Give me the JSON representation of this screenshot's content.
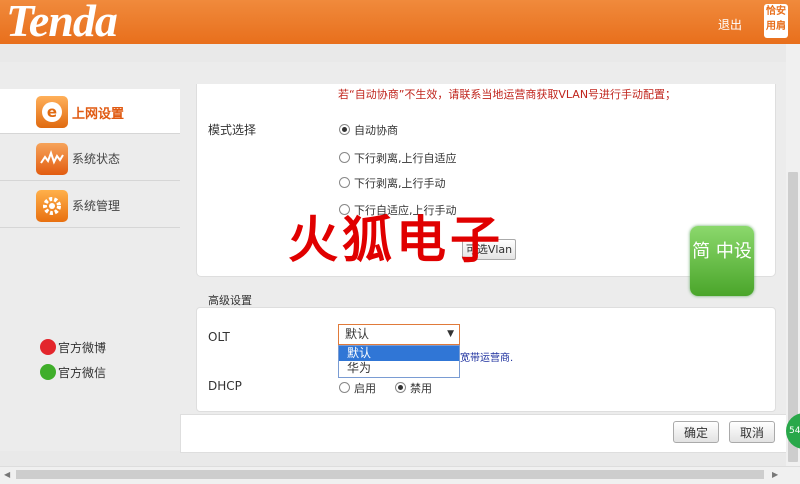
{
  "header": {
    "brand": "Tenda",
    "logout": "退出",
    "corner_badge": "恰安 用肩",
    "brand_color": "#e8731f"
  },
  "sidebar": {
    "items": [
      {
        "label": "上网设置",
        "icon": "internet-e-icon",
        "active": true
      },
      {
        "label": "系统状态",
        "icon": "status-chart-icon",
        "active": false
      },
      {
        "label": "系统管理",
        "icon": "gear-icon",
        "active": false
      }
    ],
    "social": [
      {
        "label": "官方微博",
        "icon": "weibo-icon"
      },
      {
        "label": "官方微信",
        "icon": "wechat-icon"
      }
    ]
  },
  "main": {
    "warning": "若“自动协商”不生效，请联系当地运营商获取VLAN号进行手动配置；",
    "mode_label": "模式选择",
    "mode_options": [
      {
        "label": "自动协商",
        "checked": true
      },
      {
        "label": "下行剥离,上行自适应",
        "checked": false
      },
      {
        "label": "下行剥离,上行手动",
        "checked": false
      },
      {
        "label": "下行自适应,上行手动",
        "checked": false
      }
    ],
    "vlan_button": "可选Vlan",
    "watermark": "火狐电子",
    "corner_badge": "简 中设",
    "advanced_title": "高级设置",
    "olt_label": "OLT",
    "olt_selected": "默认",
    "olt_options": [
      "默认",
      "华为"
    ],
    "olt_hint": "宽带运营商.",
    "dhcp_label": "DHCP",
    "dhcp_options": [
      {
        "label": "启用",
        "checked": false
      },
      {
        "label": "禁用",
        "checked": true
      }
    ]
  },
  "footer": {
    "ok": "确定",
    "cancel": "取消"
  },
  "misc": {
    "edge_badge": "54"
  }
}
